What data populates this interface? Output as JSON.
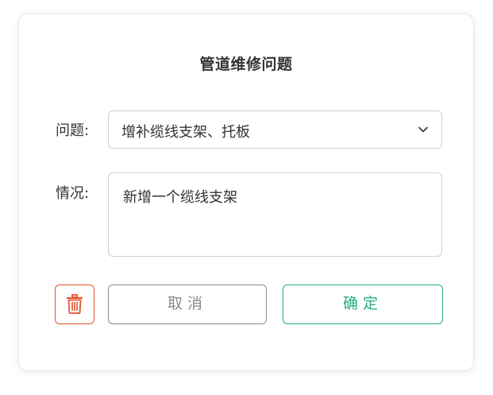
{
  "dialog": {
    "title": "管道维修问题",
    "issue_label": "问题:",
    "issue_value": "增补缆线支架、托板",
    "desc_label": "情况:",
    "desc_value": "新增一个缆线支架",
    "cancel_label": "取消",
    "confirm_label": "确定"
  },
  "icons": {
    "select_chevron": "chevron-down-icon",
    "delete": "trash-icon"
  },
  "colors": {
    "delete": "#e5532c",
    "confirm": "#23b07a",
    "cancel": "#8a8a8a",
    "text": "#333333",
    "border": "#cfcfcf"
  }
}
